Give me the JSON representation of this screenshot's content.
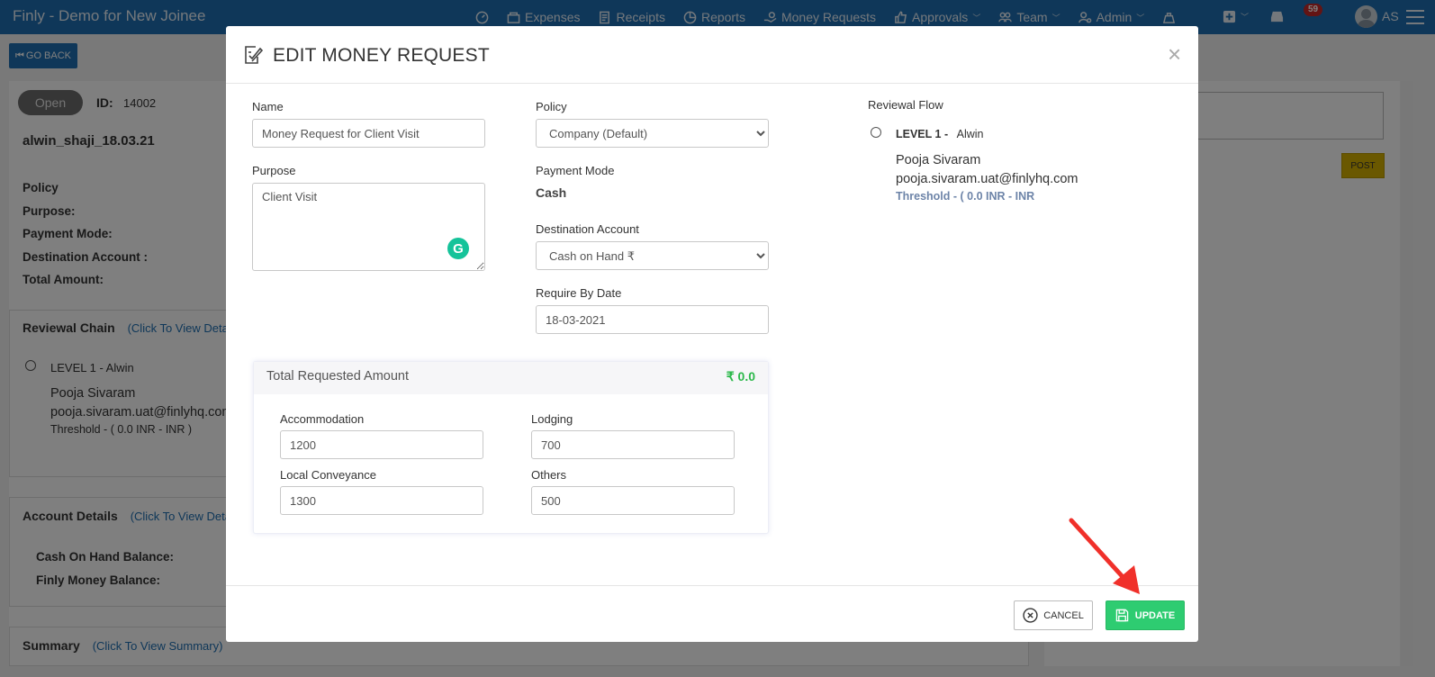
{
  "app": {
    "title": "Finly - Demo for New Joinee",
    "nav": [
      {
        "icon": "dashboard-icon",
        "label": ""
      },
      {
        "icon": "expenses-icon",
        "label": "Expenses"
      },
      {
        "icon": "receipts-icon",
        "label": "Receipts"
      },
      {
        "icon": "reports-icon",
        "label": "Reports"
      },
      {
        "icon": "money-requests-icon",
        "label": "Money Requests"
      },
      {
        "icon": "approvals-icon",
        "label": "Approvals"
      },
      {
        "icon": "team-icon",
        "label": "Team"
      },
      {
        "icon": "admin-icon",
        "label": "Admin"
      }
    ],
    "notification_count": "59",
    "user_initials": "AS"
  },
  "background": {
    "go_back": "GO BACK",
    "status": "Open",
    "id_label": "ID:",
    "id_value": "14002",
    "request_name": "alwin_shaji_18.03.21",
    "labels": [
      "Policy",
      "Purpose:",
      "Payment Mode:",
      "Destination Account :",
      "Total Amount:"
    ],
    "reviewal_chain": "Reviewal Chain",
    "reviewal_chain_link": "(Click To View Details)",
    "level": "LEVEL 1 -  Alwin",
    "reviewer_name": "Pooja Sivaram",
    "reviewer_email": "pooja.sivaram.uat@finlyhq.com",
    "threshold": "Threshold -   ( 0.0 INR - INR )",
    "account_details": "Account Details",
    "account_details_link": "(Click To View Details)",
    "cash_on_hand": "Cash On Hand Balance:",
    "finly_money": "Finly Money Balance:",
    "summary": "Summary",
    "summary_link": "(Click To View Summary)",
    "post": "POST"
  },
  "modal": {
    "title": "EDIT MONEY REQUEST",
    "name_label": "Name",
    "name_value": "Money Request for Client Visit",
    "purpose_label": "Purpose",
    "purpose_value": "Client Visit",
    "policy_label": "Policy",
    "policy_value": "Company (Default)",
    "payment_mode_label": "Payment Mode",
    "payment_mode_value": "Cash",
    "destination_label": "Destination Account",
    "destination_value": "Cash on Hand ₹",
    "require_by_label": "Require By Date",
    "require_by_value": "18-03-2021",
    "total_label": "Total Requested Amount",
    "total_value": "₹ 0.0",
    "amounts": {
      "accommodation_label": "Accommodation",
      "accommodation_value": "1200",
      "lodging_label": "Lodging",
      "lodging_value": "700",
      "conveyance_label": "Local Conveyance",
      "conveyance_value": "1300",
      "others_label": "Others",
      "others_value": "500"
    },
    "reviewal_flow_label": "Reviewal Flow",
    "level_label": "LEVEL 1 -",
    "level_name": "Alwin",
    "reviewer_name": "Pooja Sivaram",
    "reviewer_email": "pooja.sivaram.uat@finlyhq.com",
    "threshold": "Threshold -  ( 0.0 INR - INR",
    "cancel": "CANCEL",
    "update": "UPDATE"
  },
  "colors": {
    "nav": "#1f6fb2",
    "update": "#2ecc71",
    "total": "#2bb84a",
    "annotation_arrow": "#f0302a"
  }
}
